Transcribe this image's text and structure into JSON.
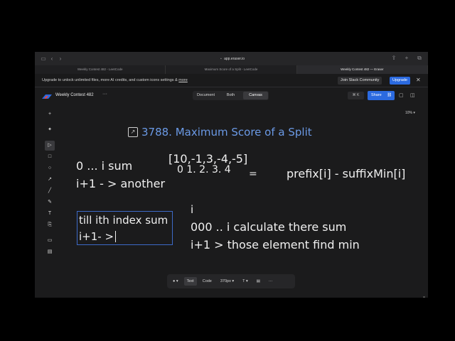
{
  "browser": {
    "url": "app.eraser.io",
    "tabs": [
      {
        "label": "Weekly Contest 482 - LeetCode",
        "active": false
      },
      {
        "label": "Maximum Score of a Split - LeetCode",
        "active": false
      },
      {
        "label": "Weekly Contest 482 — Eraser",
        "active": true
      }
    ]
  },
  "banner": {
    "text": "Upgrade to unlock unlimited files, more AI credits, and custom icons settings & ",
    "more_link": "more",
    "slack_button": "Join Slack Community",
    "upgrade_button": "Upgrade",
    "close_icon": "close-icon"
  },
  "app": {
    "title": "Weekly Contest 482",
    "more": "···",
    "view_tabs": [
      {
        "label": "Document",
        "active": false
      },
      {
        "label": "Both",
        "active": false
      },
      {
        "label": "Canvas",
        "active": true
      }
    ],
    "shortcut": "⌘ K",
    "share_button": "Share",
    "zoom": "10% ▾"
  },
  "canvas": {
    "heading": "3788. Maximum Score of a Split",
    "notes": {
      "line1": "0 ... i sum",
      "line2": "i+1 - > another",
      "array": "[10,-1,3,-4,-5]",
      "indices": "0 1. 2.  3. 4",
      "equals": "=",
      "formula": "prefix[i] - suffixMin[i]",
      "box_line1": "till ith index sum",
      "box_line2": "i+1- >",
      "i_label": "i",
      "line3": "000 .. i calculate there sum",
      "line4": "i+1 > those element find min"
    }
  },
  "bottom_toolbar": {
    "text_tab": "Text",
    "code_tab": "Code",
    "size": "370px ▾",
    "font": "T ▾"
  },
  "help": "?"
}
